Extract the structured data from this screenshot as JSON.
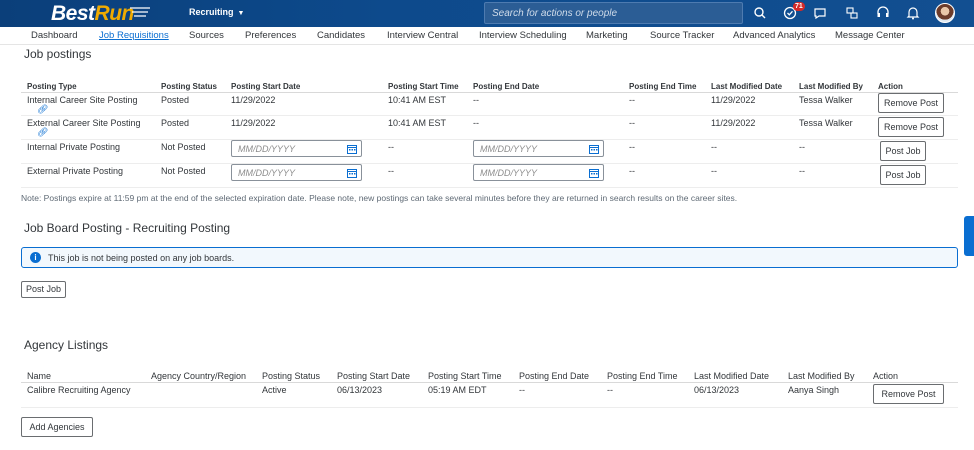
{
  "shell": {
    "logo_main": "Best",
    "logo_accent": "Run",
    "module": "Recruiting",
    "search_placeholder": "Search for actions or people",
    "notification_count": "71",
    "icons": [
      "search-icon",
      "approvals-icon",
      "feedback-icon",
      "org-chart-icon",
      "help-icon",
      "bell-icon"
    ]
  },
  "tabs": [
    "Dashboard",
    "Job Requisitions",
    "Sources",
    "Preferences",
    "Candidates",
    "Interview Central",
    "Interview Scheduling",
    "Marketing",
    "Source Tracker",
    "Advanced Analytics",
    "Message Center"
  ],
  "job_postings": {
    "title": "Job postings",
    "columns": [
      "Posting Type",
      "Posting Status",
      "Posting Start Date",
      "Posting Start Time",
      "Posting End Date",
      "Posting End Time",
      "Last Modified Date",
      "Last Modified By",
      "Action"
    ],
    "rows": [
      {
        "type": "Internal Career Site Posting",
        "status": "Posted",
        "start_date": "11/29/2022",
        "start_time": "10:41 AM EST",
        "end_date": "--",
        "end_time": "--",
        "mod_date": "11/29/2022",
        "mod_by": "Tessa Walker",
        "action": "Remove Post"
      },
      {
        "type": "External Career Site Posting",
        "status": "Posted",
        "start_date": "11/29/2022",
        "start_time": "10:41 AM EST",
        "end_date": "--",
        "end_time": "--",
        "mod_date": "11/29/2022",
        "mod_by": "Tessa Walker",
        "action": "Remove Post"
      },
      {
        "type": "Internal Private Posting",
        "status": "Not Posted",
        "start_date": "",
        "start_time": "--",
        "end_date": "",
        "end_time": "--",
        "mod_date": "--",
        "mod_by": "--",
        "action": "Post Job"
      },
      {
        "type": "External Private Posting",
        "status": "Not Posted",
        "start_date": "",
        "start_time": "--",
        "end_date": "",
        "end_time": "--",
        "mod_date": "--",
        "mod_by": "--",
        "action": "Post Job"
      }
    ],
    "date_placeholder": "MM/DD/YYYY",
    "note": "Note: Postings expire at 11:59 pm at the end of the selected expiration date. Please note, new postings can take several minutes before they are returned in search results on the career sites."
  },
  "job_board": {
    "title": "Job Board Posting - Recruiting Posting",
    "info": "This job is not being posted on any job boards.",
    "button": "Post Job"
  },
  "agency": {
    "title": "Agency Listings",
    "columns": [
      "Name",
      "Agency Country/Region",
      "Posting Status",
      "Posting Start Date",
      "Posting Start Time",
      "Posting End Date",
      "Posting End Time",
      "Last Modified Date",
      "Last Modified By",
      "Action"
    ],
    "rows": [
      {
        "name": "Calibre Recruiting Agency",
        "country": "",
        "status": "Active",
        "start_date": "06/13/2023",
        "start_time": "05:19 AM EDT",
        "end_date": "--",
        "end_time": "--",
        "mod_date": "06/13/2023",
        "mod_by": "Aanya Singh",
        "action": "Remove Post"
      }
    ],
    "button": "Add Agencies"
  }
}
